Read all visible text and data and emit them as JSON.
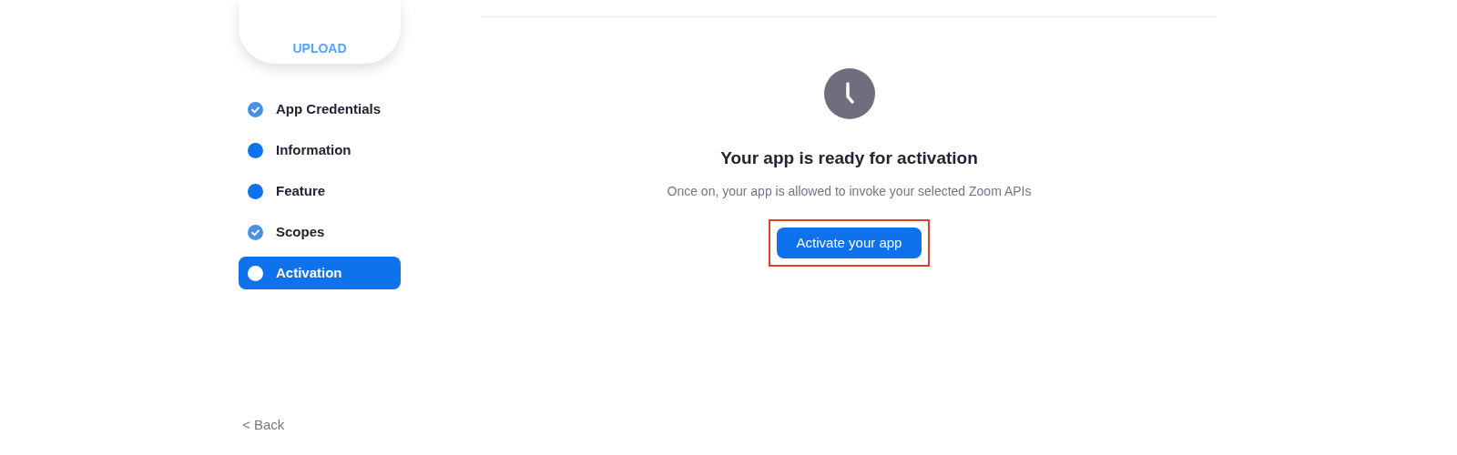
{
  "upload_card": {
    "label": "UPLOAD"
  },
  "steps": [
    {
      "label": "App Credentials",
      "complete": true,
      "selected": false
    },
    {
      "label": "Information",
      "complete": false,
      "selected": false
    },
    {
      "label": "Feature",
      "complete": false,
      "selected": false
    },
    {
      "label": "Scopes",
      "complete": true,
      "selected": false
    },
    {
      "label": "Activation",
      "complete": false,
      "selected": true
    }
  ],
  "back_link": {
    "icon": "<",
    "label": "Back"
  },
  "activation": {
    "title": "Your app is ready for activation",
    "subtitle": "Once on, your app is allowed to invoke your selected Zoom APIs",
    "button": {
      "label": "Activate your app",
      "highlighted": true
    }
  }
}
